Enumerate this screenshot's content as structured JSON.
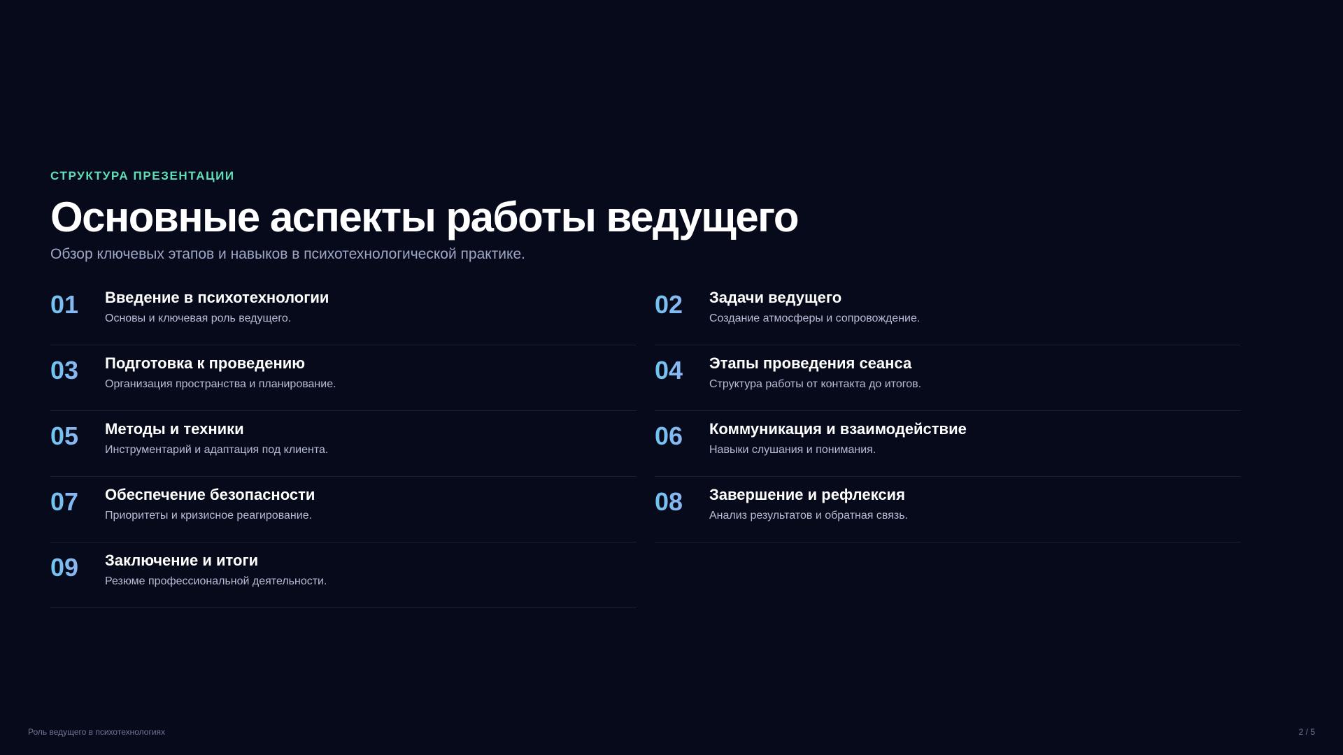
{
  "eyebrow": "СТРУКТУРА ПРЕЗЕНТАЦИИ",
  "title": "Основные аспекты работы ведущего",
  "subtitle": "Обзор ключевых этапов и навыков в психотехнологической практике.",
  "items": [
    {
      "num": "01",
      "title": "Введение в психотехнологии",
      "desc": "Основы и ключевая роль ведущего."
    },
    {
      "num": "02",
      "title": "Задачи ведущего",
      "desc": "Создание атмосферы и сопровождение."
    },
    {
      "num": "03",
      "title": "Подготовка к проведению",
      "desc": "Организация пространства и планирование."
    },
    {
      "num": "04",
      "title": "Этапы проведения сеанса",
      "desc": "Структура работы от контакта до итогов."
    },
    {
      "num": "05",
      "title": "Методы и техники",
      "desc": "Инструментарий и адаптация под клиента."
    },
    {
      "num": "06",
      "title": "Коммуникация и взаимодействие",
      "desc": "Навыки слушания и понимания."
    },
    {
      "num": "07",
      "title": "Обеспечение безопасности",
      "desc": "Приоритеты и кризисное реагирование."
    },
    {
      "num": "08",
      "title": "Завершение и рефлексия",
      "desc": "Анализ результатов и обратная связь."
    },
    {
      "num": "09",
      "title": "Заключение и итоги",
      "desc": "Резюме профессиональной деятельности."
    }
  ],
  "footer": {
    "left": "Роль ведущего в психотехнологиях",
    "right": "2 / 5"
  },
  "colors": {
    "background": "#070a1a",
    "accent": "#5ee0b8",
    "number_gradient_start": "#6fc6f0",
    "number_gradient_end": "#a6a2f3"
  }
}
